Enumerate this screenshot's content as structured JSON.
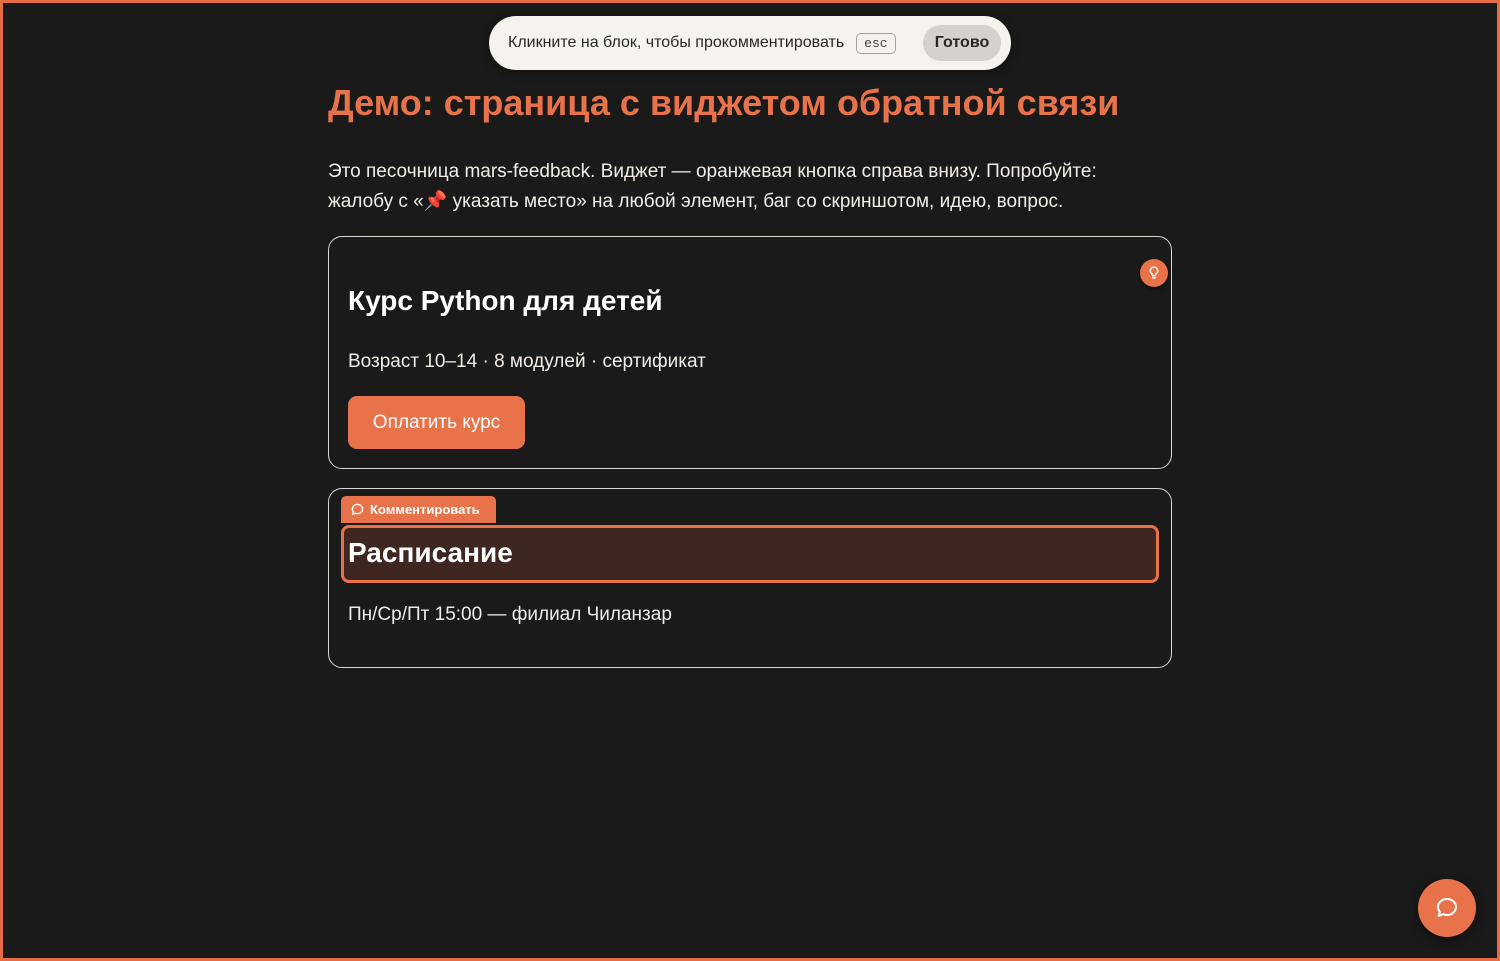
{
  "mode_bar": {
    "instruction": "Кликните на блок, чтобы прокомментировать",
    "esc_key": "esc",
    "done_label": "Готово"
  },
  "page": {
    "title": "Демо: страница с виджетом обратной связи",
    "intro_part1": "Это песочница mars-feedback. Виджет — оранжевая кнопка справа внизу. Попробуйте: жалобу с «",
    "intro_pin": "📌",
    "intro_part2": " указать место» на любой элемент, баг со скриншотом, идею, вопрос."
  },
  "course_card": {
    "title": "Курс Python для детей",
    "meta": "Возраст 10–14 · 8 модулей · сертификат",
    "pay_label": "Оплатить курс",
    "marker_icon": "lightbulb-icon"
  },
  "schedule_card": {
    "comment_tag_label": "Комментировать",
    "comment_tag_icon": "comment-icon",
    "title": "Расписание",
    "text": "Пн/Ср/Пт 15:00 — филиал Чиланзар"
  },
  "feedback_widget": {
    "icon": "chat-bubble-icon"
  },
  "colors": {
    "accent": "#e8734a",
    "background": "#1b1a1a",
    "highlight_fill": "#3e2721"
  }
}
